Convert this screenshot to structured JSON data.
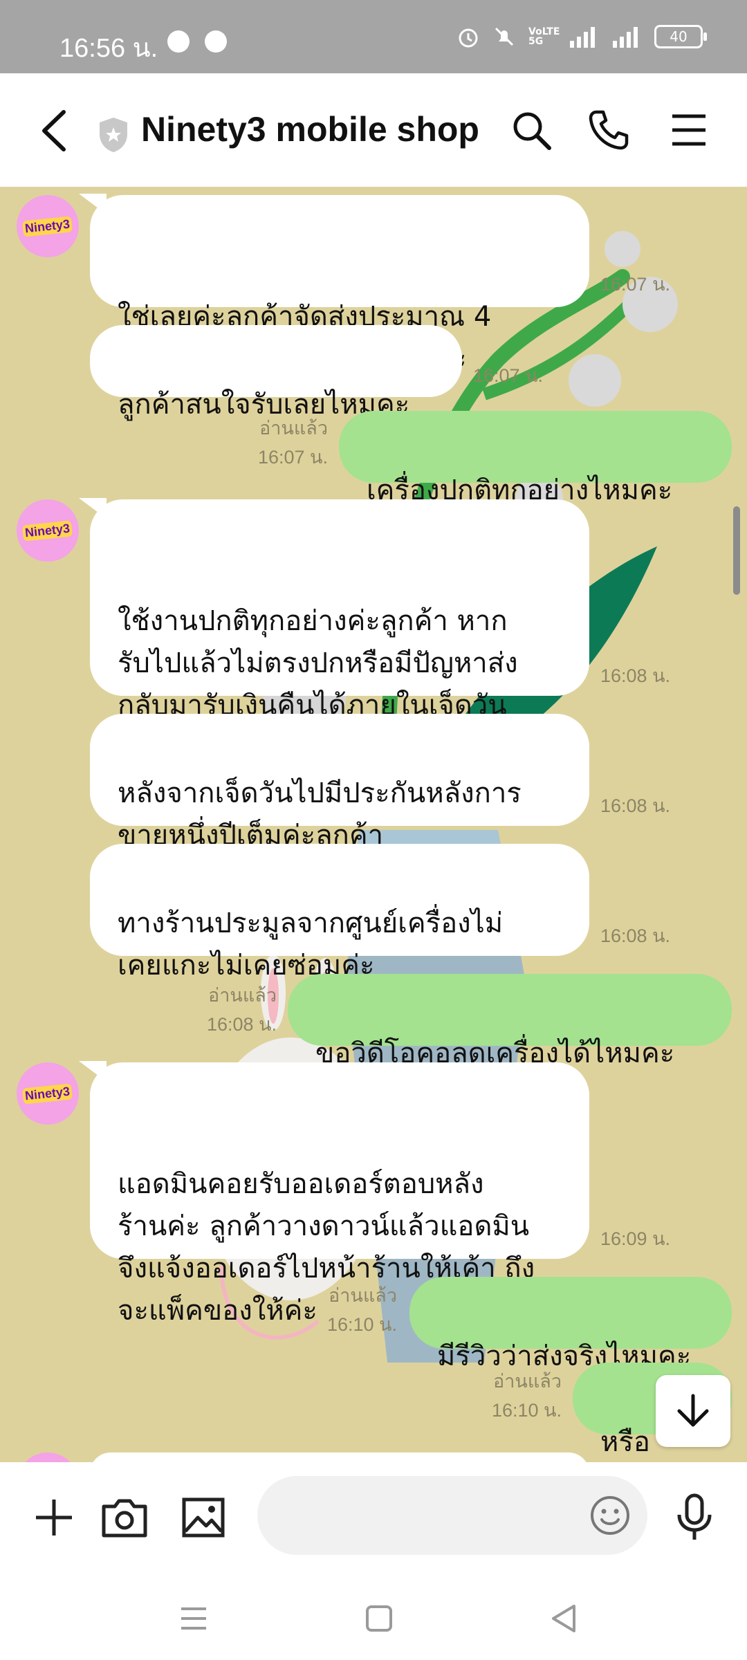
{
  "status_bar": {
    "time": "16:56 น.",
    "network": "VoLTE 5G",
    "battery": "40"
  },
  "header": {
    "title": "Ninety3 mobile shop"
  },
  "shop_avatar_text": "Ninety3",
  "messages": [
    {
      "side": "in",
      "text": "ใช่เลยค่ะลูกค้าจัดส่งประมาณ 4\nโมงเย็นนี้ค่ะตอนนี้ยังทันอยู่ค่ะ",
      "time": "16:07 น."
    },
    {
      "side": "in",
      "text": "ลูกค้าสนใจรับเลยไหมคะ",
      "time": "16:07 น."
    },
    {
      "side": "out",
      "text": "เครื่องปกติทุกอย่างไหมคะ",
      "read": "อ่านแล้ว",
      "time": "16:07 น."
    },
    {
      "side": "in",
      "text": "ใช้งานปกติทุกอย่างค่ะลูกค้า หาก\nรับไปแล้วไม่ตรงปกหรือมีปัญหาส่ง\nกลับมารับเงินคืนได้ภายในเจ็ดวัน\nค่ะ",
      "time": "16:08 น."
    },
    {
      "side": "in",
      "text": "หลังจากเจ็ดวันไปมีประกันหลังการ\nขายหนึ่งปีเต็มค่ะลูกค้า",
      "time": "16:08 น."
    },
    {
      "side": "in",
      "text": "ทางร้านประมูลจากศูนย์เครื่องไม่\nเคยแกะไม่เคยซ่อมค่ะ",
      "time": "16:08 น."
    },
    {
      "side": "out",
      "text": "ขอวิดีโอคอลดูเครื่องได้ไหมคะ",
      "read": "อ่านแล้ว",
      "time": "16:08 น."
    },
    {
      "side": "in",
      "text": "แอดมินคอยรับออเดอร์ตอบหลัง\nร้านค่ะ ลูกค้าวางดาวน์แล้วแอดมิน\nจึงแจ้งออเดอร์ไปหน้าร้านให้เค้า ถึง\nจะแพ็คของให้ค่ะ",
      "time": "16:09 น."
    },
    {
      "side": "out",
      "text": "มีรีวิวว่าส่งจริงไหมคะ",
      "read": "อ่านแล้ว",
      "time": "16:10 น."
    },
    {
      "side": "out",
      "text": "หรือ",
      "read": "อ่านแล้ว",
      "time": "16:10 น."
    }
  ],
  "input": {
    "placeholder": ""
  },
  "colors": {
    "chat_bg": "#ded29c",
    "outgoing_bubble": "#a4e28f",
    "incoming_bubble": "#ffffff",
    "status_bar": "#a5a5a5"
  },
  "icons": [
    "back-arrow-icon",
    "shield-icon",
    "search-icon",
    "phone-icon",
    "menu-icon",
    "plus-icon",
    "camera-icon",
    "image-icon",
    "emoji-icon",
    "microphone-icon",
    "arrow-down-icon"
  ]
}
